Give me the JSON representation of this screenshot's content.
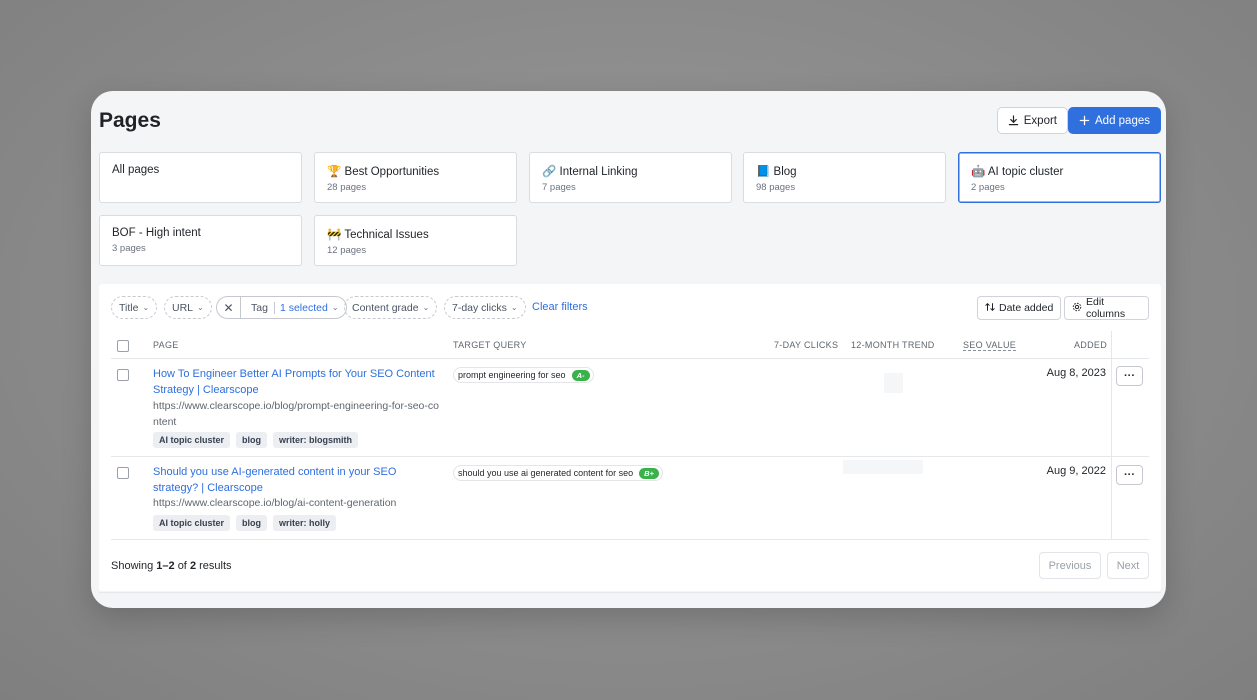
{
  "page": {
    "title": "Pages"
  },
  "header": {
    "export_label": "Export",
    "add_label": "Add pages",
    "export_icon": "download-icon",
    "add_icon": "plus-icon"
  },
  "views": [
    {
      "emoji": "",
      "name": "All pages",
      "count": ""
    },
    {
      "emoji": "🏆",
      "name": "Best Opportunities",
      "count": "28 pages"
    },
    {
      "emoji": "🔗",
      "name": "Internal Linking",
      "count": "7 pages"
    },
    {
      "emoji": "📘",
      "name": "Blog",
      "count": "98 pages"
    },
    {
      "emoji": "🤖",
      "name": "AI topic cluster",
      "count": "2 pages",
      "active": true
    },
    {
      "emoji": "",
      "name": "BOF - High intent",
      "count": "3 pages"
    },
    {
      "emoji": "🚧",
      "name": "Technical Issues",
      "count": "12 pages"
    }
  ],
  "filters": {
    "title": "Title",
    "url": "URL",
    "tag": "Tag",
    "tag_selected": "1 selected",
    "content_grade": "Content grade",
    "clicks": "7-day clicks",
    "clear": "Clear filters",
    "date_added": "Date added",
    "edit_columns": "Edit columns"
  },
  "columns": {
    "page": "PAGE",
    "query": "TARGET QUERY",
    "clicks": "7-DAY CLICKS",
    "trend": "12-MONTH TREND",
    "seo": "SEO VALUE",
    "added": "ADDED"
  },
  "rows": [
    {
      "title": "How To Engineer Better AI Prompts for Your SEO Content Strategy | Clearscope",
      "url": "https://www.clearscope.io/blog/prompt-engineering-for-seo-content",
      "tags": [
        "AI topic cluster",
        "blog",
        "writer: blogsmith"
      ],
      "query": "prompt engineering for seo",
      "grade": "A-",
      "added": "Aug 8, 2023",
      "more": "···"
    },
    {
      "title": "Should you use AI-generated content in your SEO strategy? | Clearscope",
      "url": "https://www.clearscope.io/blog/ai-content-generation",
      "tags": [
        "AI topic cluster",
        "blog",
        "writer: holly"
      ],
      "query": "should you use ai generated content for seo",
      "grade": "B+",
      "added": "Aug 9, 2022",
      "more": "···"
    }
  ],
  "footer": {
    "showing_prefix": "Showing",
    "range": "1–2",
    "of": "of",
    "total": "2",
    "suffix": "results",
    "previous": "Previous",
    "next": "Next"
  },
  "colors": {
    "accent": "#2f6fde",
    "grade": "#3ab14a"
  }
}
